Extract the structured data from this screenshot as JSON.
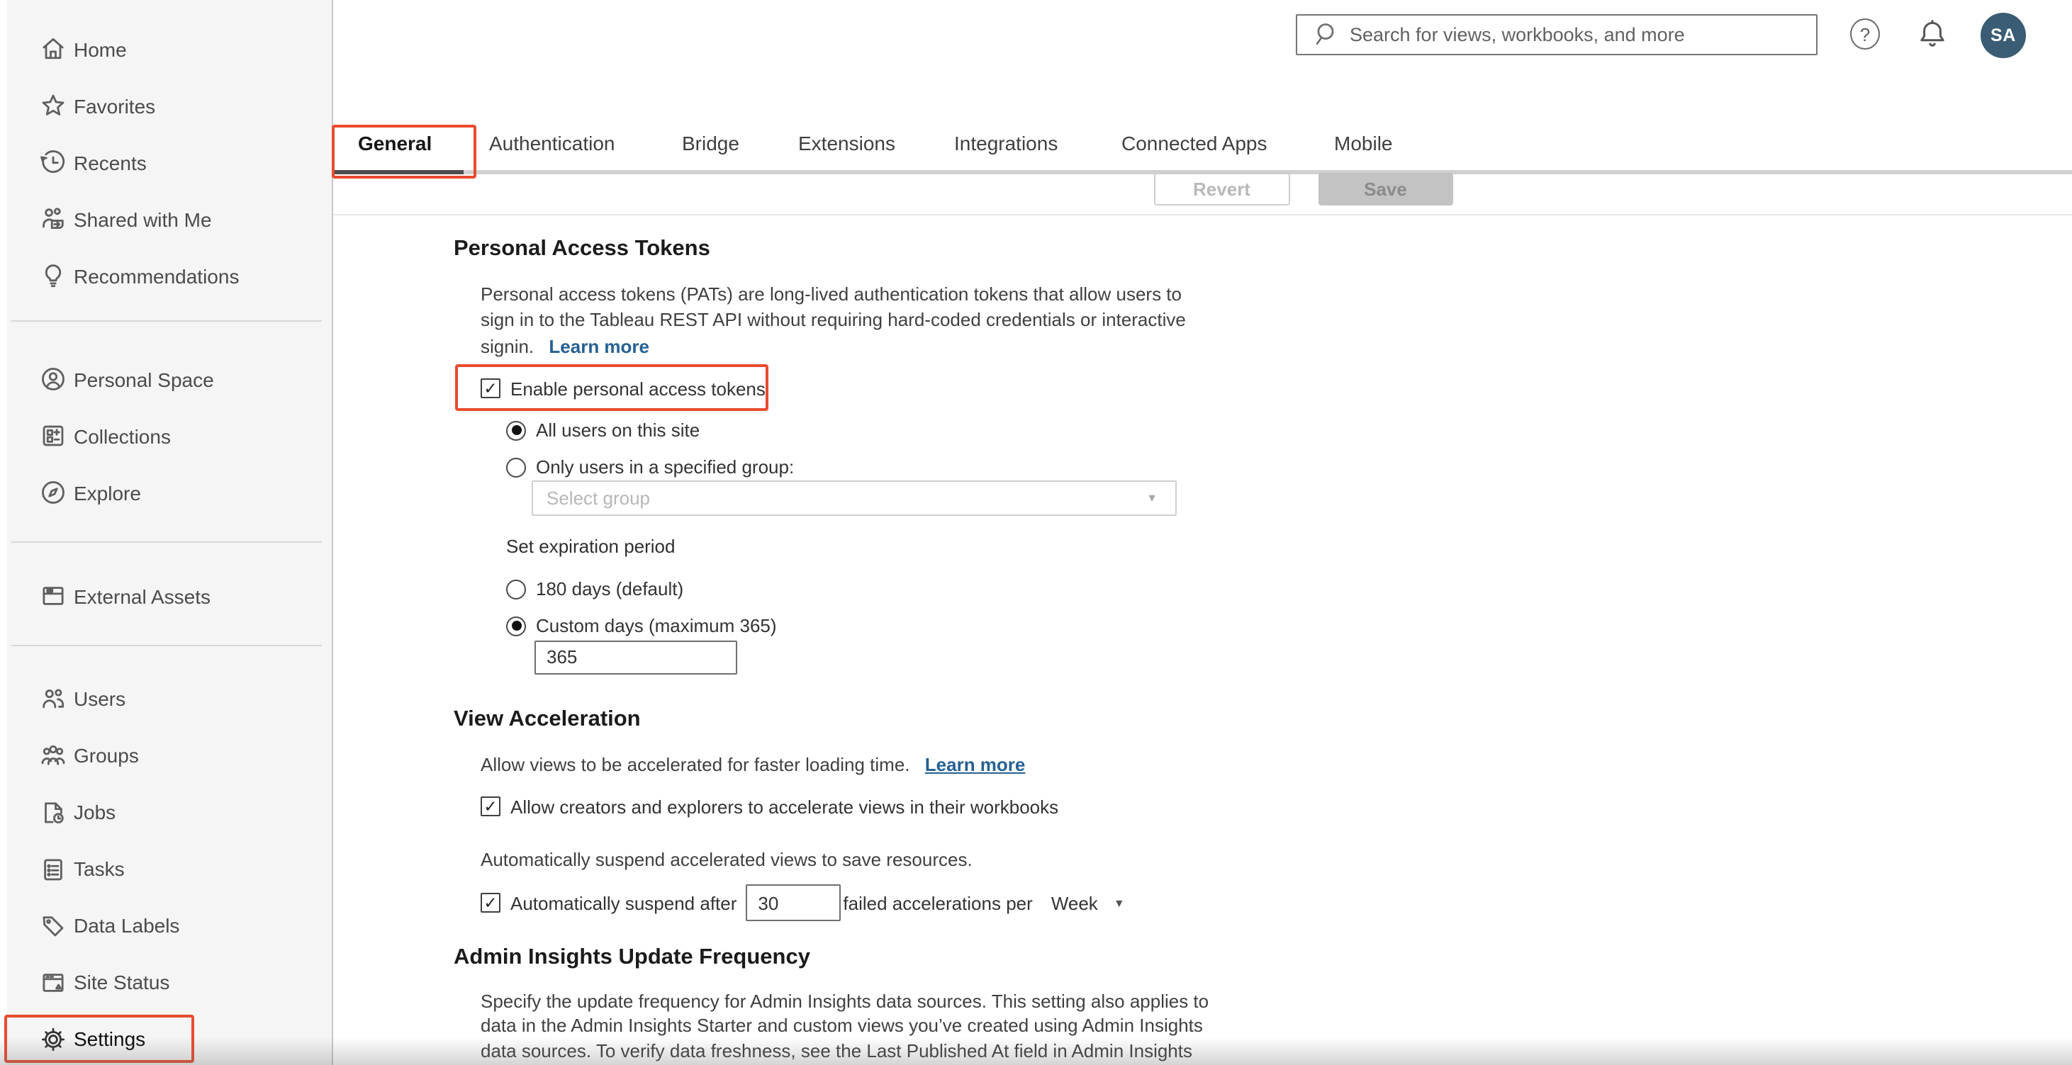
{
  "colors": {
    "annotation_red": "#e94b2f",
    "avatar_bg": "#3a5c74",
    "link_blue": "#266192",
    "active_tab_underline": "#4d4d4d",
    "sidebar_bg": "#f5f5f5"
  },
  "header": {
    "search": {
      "placeholder": "Search for views, workbooks, and more",
      "icon": "search-icon"
    },
    "help_icon": "help-icon",
    "help_glyph": "?",
    "notifications_icon": "bell-icon",
    "avatar_initials": "SA"
  },
  "sidebar": {
    "groups": [
      {
        "items": [
          {
            "label": "Home",
            "icon": "home-icon"
          },
          {
            "label": "Favorites",
            "icon": "star-icon"
          },
          {
            "label": "Recents",
            "icon": "history-icon"
          },
          {
            "label": "Shared with Me",
            "icon": "shared-icon"
          },
          {
            "label": "Recommendations",
            "icon": "lightbulb-icon"
          }
        ]
      },
      {
        "items": [
          {
            "label": "Personal Space",
            "icon": "person-circle-icon"
          },
          {
            "label": "Collections",
            "icon": "collections-icon"
          },
          {
            "label": "Explore",
            "icon": "compass-icon"
          }
        ]
      },
      {
        "items": [
          {
            "label": "External Assets",
            "icon": "box-icon"
          }
        ]
      },
      {
        "items": [
          {
            "label": "Users",
            "icon": "users-icon"
          },
          {
            "label": "Groups",
            "icon": "groups-icon"
          },
          {
            "label": "Jobs",
            "icon": "jobs-icon"
          },
          {
            "label": "Tasks",
            "icon": "tasks-icon"
          },
          {
            "label": "Data Labels",
            "icon": "tag-icon"
          },
          {
            "label": "Site Status",
            "icon": "site-status-icon"
          },
          {
            "label": "Settings",
            "icon": "gear-icon",
            "active": true
          }
        ]
      }
    ]
  },
  "tabs": {
    "items": [
      {
        "label": "General",
        "active": true
      },
      {
        "label": "Authentication"
      },
      {
        "label": "Bridge"
      },
      {
        "label": "Extensions"
      },
      {
        "label": "Integrations"
      },
      {
        "label": "Connected Apps"
      },
      {
        "label": "Mobile"
      }
    ]
  },
  "toolbar": {
    "revert_label": "Revert",
    "save_label": "Save"
  },
  "pat": {
    "title": "Personal Access Tokens",
    "description_lines": [
      "Personal access tokens (PATs) are long-lived authentication tokens that allow users to",
      "sign in to the Tableau REST API without requiring hard-coded credentials or interactive",
      "signin."
    ],
    "learn_more_label": "Learn more",
    "enable_checkbox_label": "Enable personal access tokens",
    "radio_all_users_label": "All users on this site",
    "radio_specified_group_label": "Only users in a specified group:",
    "group_select_placeholder": "Select group",
    "expiration_label": "Set expiration period",
    "radio_default_label": "180 days (default)",
    "radio_custom_label": "Custom days (maximum 365)",
    "custom_days_value": "365"
  },
  "view_acceleration": {
    "title": "View Acceleration",
    "description": "Allow views to be accelerated for faster loading time.",
    "learn_more_label": "Learn more",
    "allow_checkbox_label": "Allow creators and explorers to accelerate views in their workbooks",
    "suspend_description": "Automatically suspend accelerated views to save resources.",
    "suspend_checkbox_label": "Automatically suspend after",
    "suspend_count_value": "30",
    "suspend_unit_label": "failed accelerations per",
    "period_value": "Week"
  },
  "admin_insights": {
    "title": "Admin Insights Update Frequency",
    "description_lines": [
      "Specify the update frequency for Admin Insights data sources. This setting also applies to",
      "data in the Admin Insights Starter and custom views you’ve created using Admin Insights",
      "data sources. To verify data freshness, see the Last Published At field in Admin Insights"
    ]
  }
}
